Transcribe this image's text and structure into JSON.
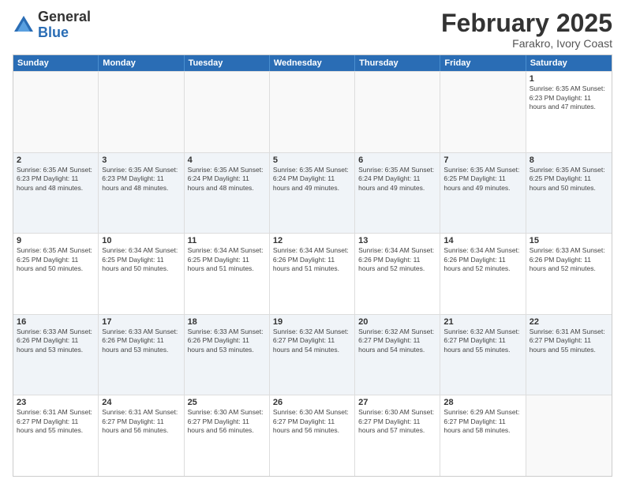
{
  "header": {
    "logo_general": "General",
    "logo_blue": "Blue",
    "month_title": "February 2025",
    "location": "Farakro, Ivory Coast"
  },
  "days": [
    "Sunday",
    "Monday",
    "Tuesday",
    "Wednesday",
    "Thursday",
    "Friday",
    "Saturday"
  ],
  "weeks": [
    [
      {
        "day": "",
        "info": ""
      },
      {
        "day": "",
        "info": ""
      },
      {
        "day": "",
        "info": ""
      },
      {
        "day": "",
        "info": ""
      },
      {
        "day": "",
        "info": ""
      },
      {
        "day": "",
        "info": ""
      },
      {
        "day": "1",
        "info": "Sunrise: 6:35 AM\nSunset: 6:23 PM\nDaylight: 11 hours\nand 47 minutes."
      }
    ],
    [
      {
        "day": "2",
        "info": "Sunrise: 6:35 AM\nSunset: 6:23 PM\nDaylight: 11 hours\nand 48 minutes."
      },
      {
        "day": "3",
        "info": "Sunrise: 6:35 AM\nSunset: 6:23 PM\nDaylight: 11 hours\nand 48 minutes."
      },
      {
        "day": "4",
        "info": "Sunrise: 6:35 AM\nSunset: 6:24 PM\nDaylight: 11 hours\nand 48 minutes."
      },
      {
        "day": "5",
        "info": "Sunrise: 6:35 AM\nSunset: 6:24 PM\nDaylight: 11 hours\nand 49 minutes."
      },
      {
        "day": "6",
        "info": "Sunrise: 6:35 AM\nSunset: 6:24 PM\nDaylight: 11 hours\nand 49 minutes."
      },
      {
        "day": "7",
        "info": "Sunrise: 6:35 AM\nSunset: 6:25 PM\nDaylight: 11 hours\nand 49 minutes."
      },
      {
        "day": "8",
        "info": "Sunrise: 6:35 AM\nSunset: 6:25 PM\nDaylight: 11 hours\nand 50 minutes."
      }
    ],
    [
      {
        "day": "9",
        "info": "Sunrise: 6:35 AM\nSunset: 6:25 PM\nDaylight: 11 hours\nand 50 minutes."
      },
      {
        "day": "10",
        "info": "Sunrise: 6:34 AM\nSunset: 6:25 PM\nDaylight: 11 hours\nand 50 minutes."
      },
      {
        "day": "11",
        "info": "Sunrise: 6:34 AM\nSunset: 6:25 PM\nDaylight: 11 hours\nand 51 minutes."
      },
      {
        "day": "12",
        "info": "Sunrise: 6:34 AM\nSunset: 6:26 PM\nDaylight: 11 hours\nand 51 minutes."
      },
      {
        "day": "13",
        "info": "Sunrise: 6:34 AM\nSunset: 6:26 PM\nDaylight: 11 hours\nand 52 minutes."
      },
      {
        "day": "14",
        "info": "Sunrise: 6:34 AM\nSunset: 6:26 PM\nDaylight: 11 hours\nand 52 minutes."
      },
      {
        "day": "15",
        "info": "Sunrise: 6:33 AM\nSunset: 6:26 PM\nDaylight: 11 hours\nand 52 minutes."
      }
    ],
    [
      {
        "day": "16",
        "info": "Sunrise: 6:33 AM\nSunset: 6:26 PM\nDaylight: 11 hours\nand 53 minutes."
      },
      {
        "day": "17",
        "info": "Sunrise: 6:33 AM\nSunset: 6:26 PM\nDaylight: 11 hours\nand 53 minutes."
      },
      {
        "day": "18",
        "info": "Sunrise: 6:33 AM\nSunset: 6:26 PM\nDaylight: 11 hours\nand 53 minutes."
      },
      {
        "day": "19",
        "info": "Sunrise: 6:32 AM\nSunset: 6:27 PM\nDaylight: 11 hours\nand 54 minutes."
      },
      {
        "day": "20",
        "info": "Sunrise: 6:32 AM\nSunset: 6:27 PM\nDaylight: 11 hours\nand 54 minutes."
      },
      {
        "day": "21",
        "info": "Sunrise: 6:32 AM\nSunset: 6:27 PM\nDaylight: 11 hours\nand 55 minutes."
      },
      {
        "day": "22",
        "info": "Sunrise: 6:31 AM\nSunset: 6:27 PM\nDaylight: 11 hours\nand 55 minutes."
      }
    ],
    [
      {
        "day": "23",
        "info": "Sunrise: 6:31 AM\nSunset: 6:27 PM\nDaylight: 11 hours\nand 55 minutes."
      },
      {
        "day": "24",
        "info": "Sunrise: 6:31 AM\nSunset: 6:27 PM\nDaylight: 11 hours\nand 56 minutes."
      },
      {
        "day": "25",
        "info": "Sunrise: 6:30 AM\nSunset: 6:27 PM\nDaylight: 11 hours\nand 56 minutes."
      },
      {
        "day": "26",
        "info": "Sunrise: 6:30 AM\nSunset: 6:27 PM\nDaylight: 11 hours\nand 56 minutes."
      },
      {
        "day": "27",
        "info": "Sunrise: 6:30 AM\nSunset: 6:27 PM\nDaylight: 11 hours\nand 57 minutes."
      },
      {
        "day": "28",
        "info": "Sunrise: 6:29 AM\nSunset: 6:27 PM\nDaylight: 11 hours\nand 58 minutes."
      },
      {
        "day": "",
        "info": ""
      }
    ]
  ]
}
